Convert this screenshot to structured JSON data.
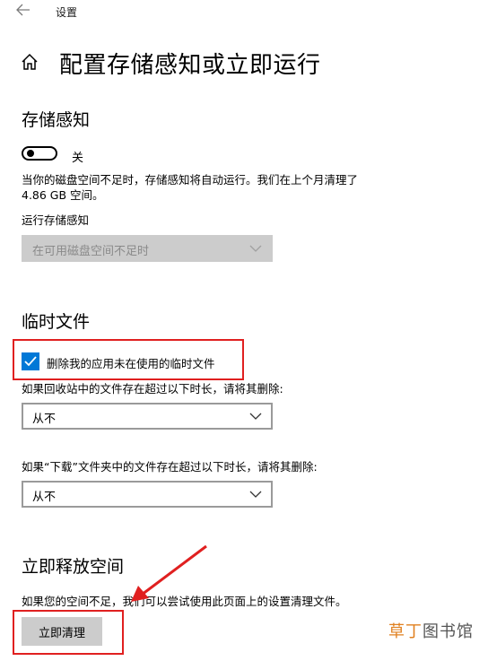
{
  "titlebar": {
    "back_icon": "back-arrow-icon",
    "title": "设置"
  },
  "page": {
    "home_icon": "home-icon",
    "title": "配置存储感知或立即运行"
  },
  "storage_sense": {
    "heading": "存储感知",
    "toggle_state": "off",
    "toggle_label": "关",
    "description_line1": "当你的磁盘空间不足时，存储感知将自动运行。我们在上个月清理了",
    "description_line2": "4.86 GB 空间。",
    "run_label": "运行存储感知",
    "run_select_value": "在可用磁盘空间不足时"
  },
  "temp_files": {
    "heading": "临时文件",
    "delete_checkbox_checked": true,
    "delete_checkbox_label": "删除我的应用未在使用的临时文件",
    "recycle_label": "如果回收站中的文件存在超过以下时长，请将其删除:",
    "recycle_select_value": "从不",
    "downloads_label": "如果“下载”文件夹中的文件存在超过以下时长，请将其删除:",
    "downloads_select_value": "从不"
  },
  "free_space": {
    "heading": "立即释放空间",
    "description": "如果您的空间不足，我们可以尝试使用此页面上的设置清理文件。",
    "clean_button_label": "立即清理"
  },
  "watermark": {
    "part_a": "草丁",
    "part_b": "图书馆"
  },
  "colors": {
    "accent": "#0078d7",
    "annotation": "#e02020",
    "button_bg": "#cccccc"
  }
}
